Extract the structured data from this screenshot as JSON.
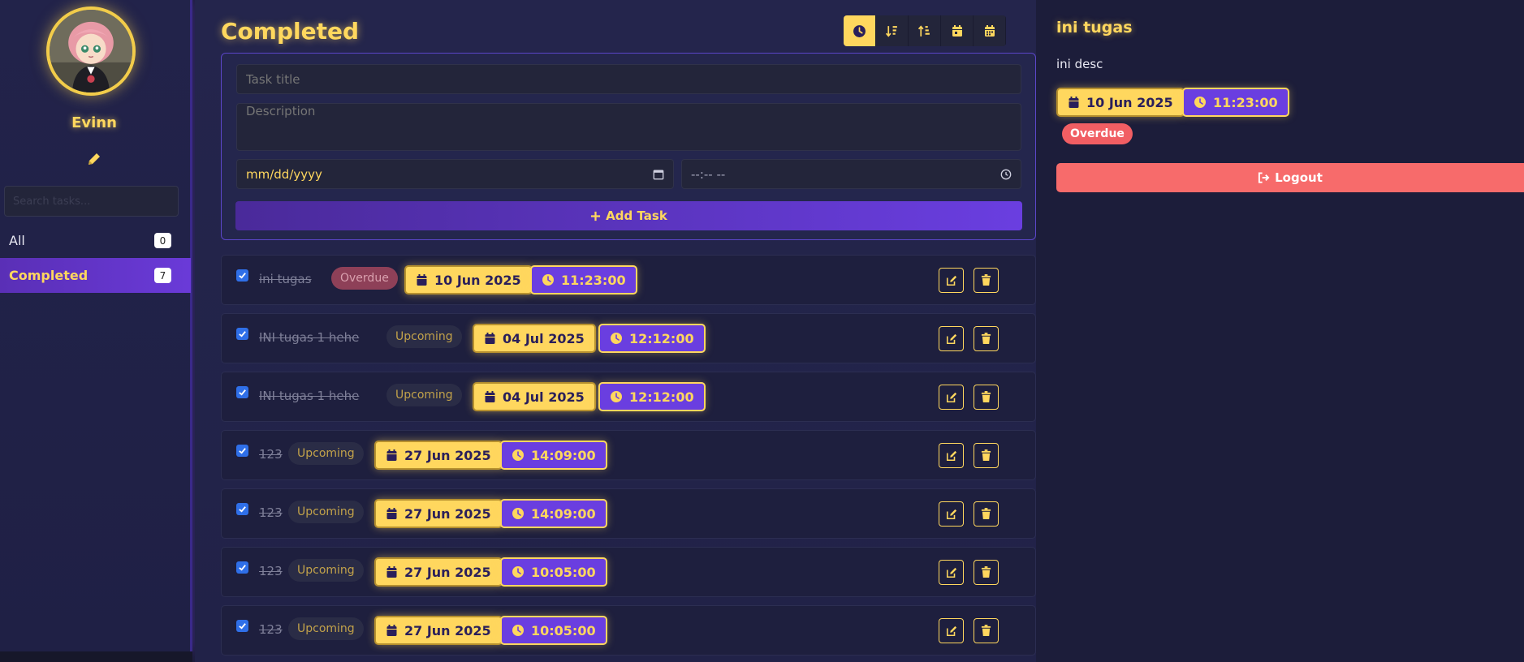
{
  "profile": {
    "name": "Evinn",
    "search_placeholder": "Search tasks..."
  },
  "nav": {
    "items": [
      {
        "label": "All",
        "count": "0"
      },
      {
        "label": "Completed",
        "count": "7"
      }
    ]
  },
  "main": {
    "title": "Completed",
    "sort_buttons": [
      "clock-icon",
      "sort-amount-down-icon",
      "sort-amount-up-icon",
      "calendar-day-icon",
      "calendar-alt-icon"
    ]
  },
  "form": {
    "title_placeholder": "Task title",
    "desc_placeholder": "Description",
    "date_placeholder": "mm/dd/yyyy",
    "time_placeholder": "--:-- --",
    "add_label": "Add Task"
  },
  "tasks": [
    {
      "title": "ini tugas",
      "status": "Overdue",
      "date": "10 Jun 2025",
      "time": "11:23:00",
      "completed": true
    },
    {
      "title": "INI tugas 1 hehe",
      "status": "Upcoming",
      "date": "04 Jul 2025",
      "time": "12:12:00",
      "completed": true
    },
    {
      "title": "INI tugas 1 hehe",
      "status": "Upcoming",
      "date": "04 Jul 2025",
      "time": "12:12:00",
      "completed": true
    },
    {
      "title": "123",
      "status": "Upcoming",
      "date": "27 Jun 2025",
      "time": "14:09:00",
      "completed": true
    },
    {
      "title": "123",
      "status": "Upcoming",
      "date": "27 Jun 2025",
      "time": "14:09:00",
      "completed": true
    },
    {
      "title": "123",
      "status": "Upcoming",
      "date": "27 Jun 2025",
      "time": "10:05:00",
      "completed": true
    },
    {
      "title": "123",
      "status": "Upcoming",
      "date": "27 Jun 2025",
      "time": "10:05:00",
      "completed": true
    }
  ],
  "detail": {
    "title": "ini tugas",
    "description": "ini desc",
    "date": "10 Jun 2025",
    "time": "11:23:00",
    "status": "Overdue",
    "logout_label": "Logout"
  },
  "colors": {
    "accent_yellow": "#ffd75e",
    "accent_purple": "#6a3ee0",
    "overdue_red": "#f15e63",
    "background": "#1c1d3a"
  }
}
